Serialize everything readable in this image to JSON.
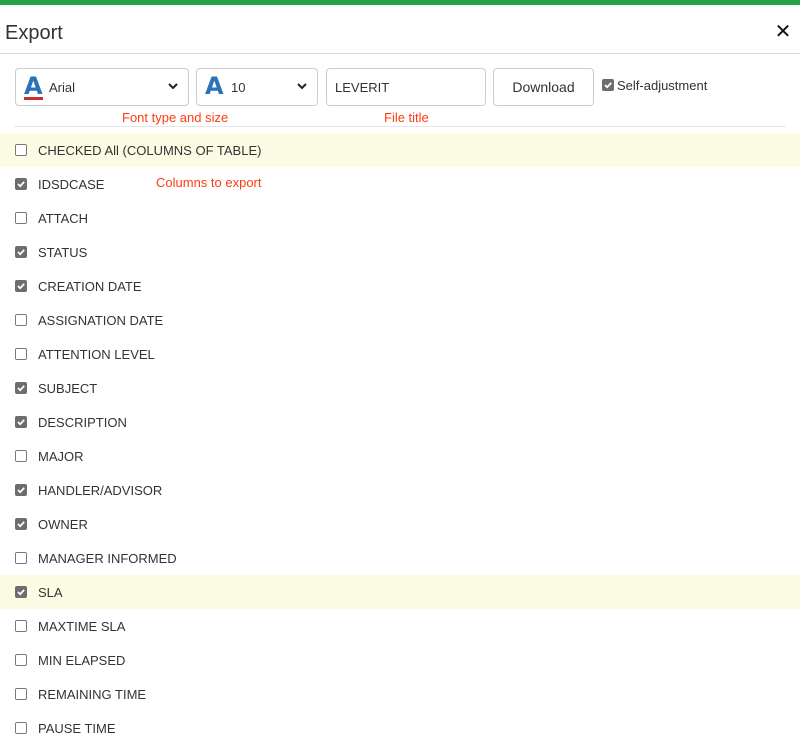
{
  "dialog": {
    "title": "Export"
  },
  "toolbar": {
    "font_type": {
      "value": "Arial",
      "icon": "font-type-icon",
      "accent_color": "#c9302c"
    },
    "font_size": {
      "value": "10",
      "icon": "font-size-icon"
    },
    "file_title": {
      "value": "LEVERIT"
    },
    "download_label": "Download",
    "self_adjustment": {
      "label": "Self-adjustment",
      "checked": true
    }
  },
  "hints": {
    "font": "Font type and size",
    "file": "File title",
    "columns": "Columns to export"
  },
  "columns": {
    "check_all": {
      "label": "CHECKED All (COLUMNS OF TABLE)",
      "checked": false
    },
    "items": [
      {
        "label": "IDSDCASE",
        "checked": true
      },
      {
        "label": "ATTACH",
        "checked": false
      },
      {
        "label": "STATUS",
        "checked": true
      },
      {
        "label": "CREATION DATE",
        "checked": true
      },
      {
        "label": "ASSIGNATION DATE",
        "checked": false
      },
      {
        "label": "ATTENTION LEVEL",
        "checked": false
      },
      {
        "label": "SUBJECT",
        "checked": true
      },
      {
        "label": "DESCRIPTION",
        "checked": true
      },
      {
        "label": "MAJOR",
        "checked": false
      },
      {
        "label": "HANDLER/ADVISOR",
        "checked": true
      },
      {
        "label": "OWNER",
        "checked": true
      },
      {
        "label": "MANAGER INFORMED",
        "checked": false
      },
      {
        "label": "SLA",
        "checked": true
      },
      {
        "label": "MAXTIME SLA",
        "checked": false
      },
      {
        "label": "MIN ELAPSED",
        "checked": false
      },
      {
        "label": "REMAINING TIME",
        "checked": false
      },
      {
        "label": "PAUSE TIME",
        "checked": false
      }
    ]
  },
  "colors": {
    "accent_green": "#22a447",
    "hint_red": "#ff3b10",
    "row_highlight": "#fcfbe3",
    "font_icon_blue": "#2b73b8"
  }
}
